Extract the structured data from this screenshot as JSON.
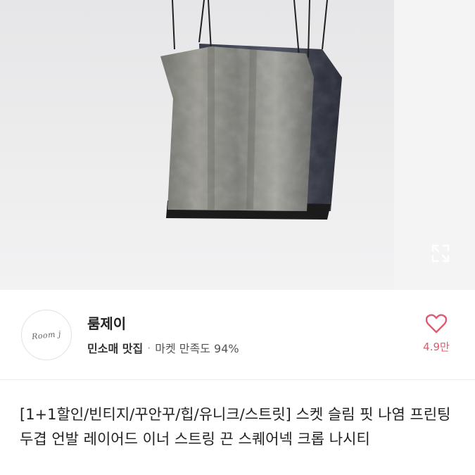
{
  "product": {
    "image_alt": "camisole product photo",
    "title": "[1+1할인/빈티지/꾸안꾸/힙/유니크/스트릿] 스켓 슬림 핏 나염 프린팅 두겹 언발 레이어드 이너 스트링 끈 스퀘어넥 크롭 나시티"
  },
  "seller": {
    "avatar_text": "Room j",
    "name": "룸제이",
    "tag": "민소매 맛집",
    "satisfaction": "마켓 만족도 94%"
  },
  "like": {
    "count": "4.9만",
    "color": "#e05a72"
  },
  "icons": {
    "expand": "expand-icon",
    "heart": "heart-outline-icon"
  }
}
